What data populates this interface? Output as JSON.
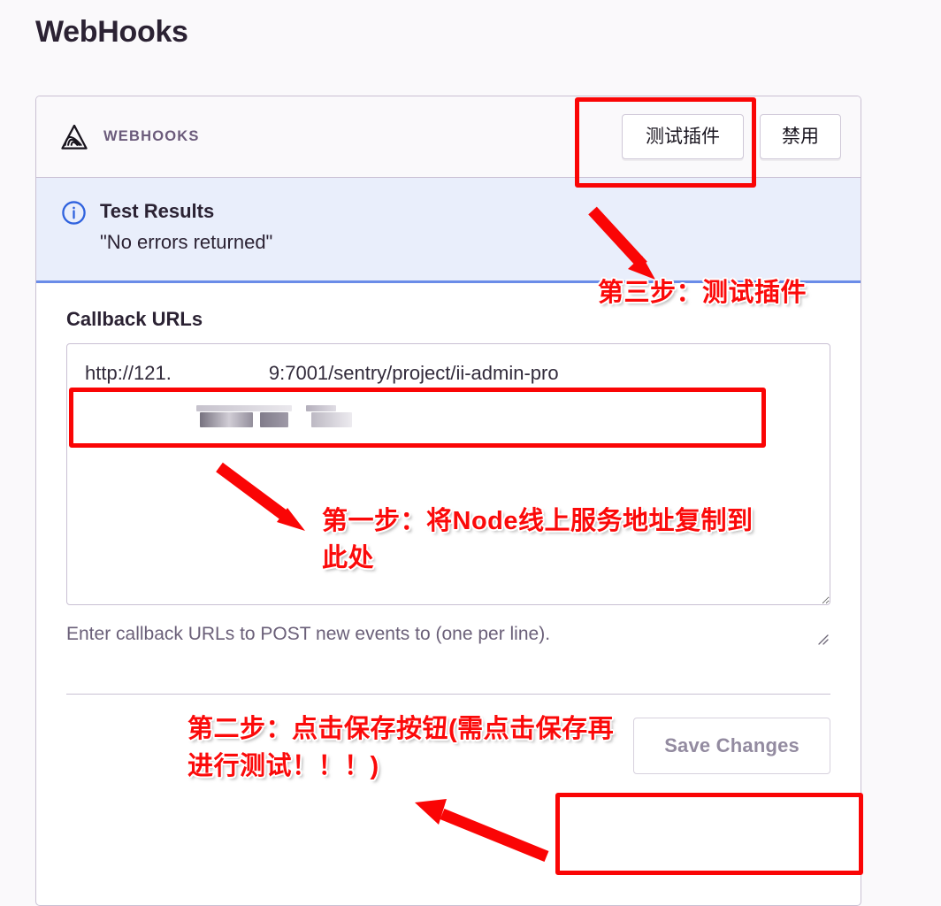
{
  "page": {
    "title": "WebHooks",
    "background_color": "#faf9fb"
  },
  "plugin_panel": {
    "logo_icon": "webhooks-triangle-logo",
    "name": "WEBHOOKS",
    "buttons": {
      "test_plugin": "测试插件",
      "disable": "禁用"
    }
  },
  "info_banner": {
    "icon": "info-circle-icon",
    "title": "Test Results",
    "message": "\"No errors returned\"",
    "background_color": "#e9eefb",
    "accent_color": "#6a8ce8"
  },
  "form": {
    "label": "Callback URLs",
    "textarea": {
      "value": "http://121.                  9:7001/sentry/project/ii-admin-pro",
      "placeholder": "",
      "redacted": true
    },
    "help_text": "Enter callback URLs to POST new events to (one per line).",
    "save_button": "Save Changes"
  },
  "annotations": {
    "color": "#fb0a0a",
    "step_one": "第一步：将Node线上服务地址复制到\n此处",
    "step_two": "第二步：点击保存按钮(需点击保存再\n进行测试！！！)",
    "step_three": "第三步：测试插件"
  }
}
